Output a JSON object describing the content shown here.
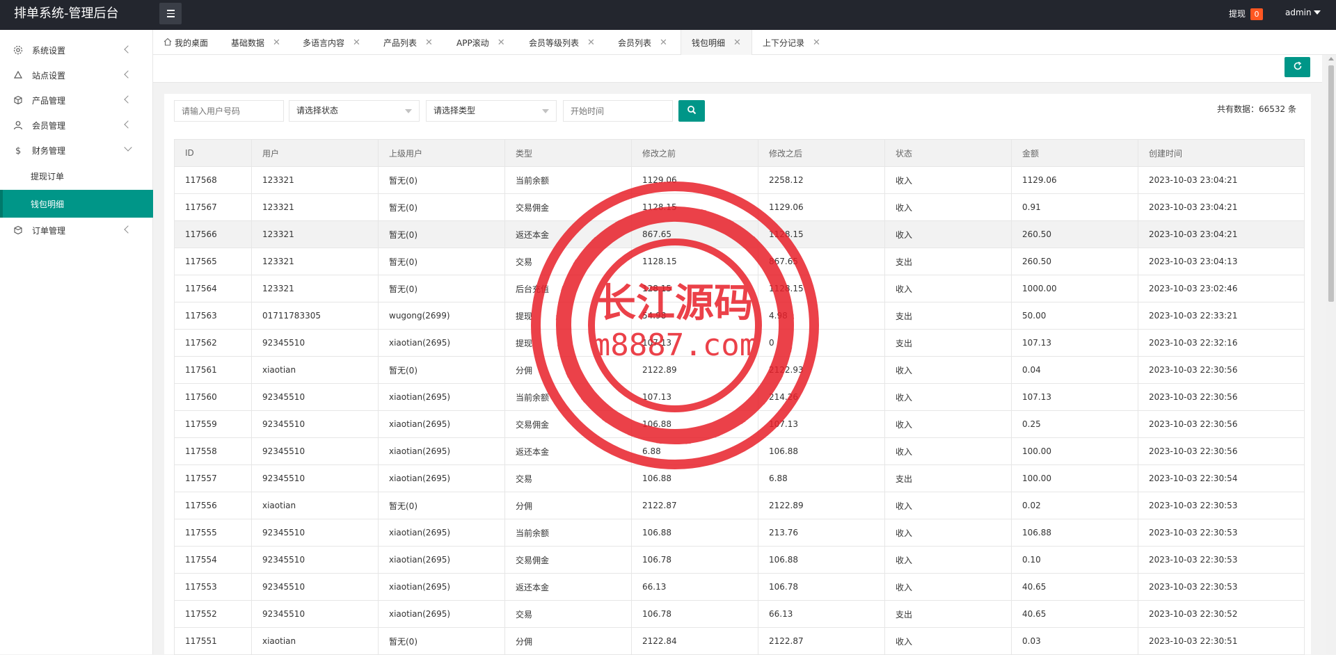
{
  "header": {
    "title": "排单系统-管理后台",
    "withdraw_label": "提现",
    "withdraw_badge": "0",
    "user": "admin"
  },
  "sidebar": {
    "items": [
      {
        "label": "系统设置",
        "icon": "gear-icon"
      },
      {
        "label": "站点设置",
        "icon": "site-icon"
      },
      {
        "label": "产品管理",
        "icon": "box-icon"
      },
      {
        "label": "会员管理",
        "icon": "user-icon"
      },
      {
        "label": "财务管理",
        "icon": "dollar-icon"
      },
      {
        "label": "订单管理",
        "icon": "order-icon"
      }
    ],
    "sub_items": [
      {
        "label": "提现订单"
      },
      {
        "label": "钱包明细"
      }
    ]
  },
  "tabs": [
    {
      "label": "我的桌面"
    },
    {
      "label": "基础数据"
    },
    {
      "label": "多语言内容"
    },
    {
      "label": "产品列表"
    },
    {
      "label": "APP滚动"
    },
    {
      "label": "会员等级列表"
    },
    {
      "label": "会员列表"
    },
    {
      "label": "钱包明细"
    },
    {
      "label": "上下分记录"
    }
  ],
  "filters": {
    "user_placeholder": "请输入用户号码",
    "status_select": "请选择状态",
    "type_select": "请选择类型",
    "time_placeholder": "开始时间"
  },
  "total_text": "共有数据：66532 条",
  "table": {
    "headers": [
      "ID",
      "用户",
      "上级用户",
      "类型",
      "修改之前",
      "修改之后",
      "状态",
      "金额",
      "创建时间"
    ],
    "rows": [
      [
        "117568",
        "123321",
        "暂无(0)",
        "当前余额",
        "1129.06",
        "2258.12",
        "收入",
        "1129.06",
        "2023-10-03 23:04:21"
      ],
      [
        "117567",
        "123321",
        "暂无(0)",
        "交易佣金",
        "1128.15",
        "1129.06",
        "收入",
        "0.91",
        "2023-10-03 23:04:21"
      ],
      [
        "117566",
        "123321",
        "暂无(0)",
        "返还本金",
        "867.65",
        "1128.15",
        "收入",
        "260.50",
        "2023-10-03 23:04:21"
      ],
      [
        "117565",
        "123321",
        "暂无(0)",
        "交易",
        "1128.15",
        "867.65",
        "支出",
        "260.50",
        "2023-10-03 23:04:13"
      ],
      [
        "117564",
        "123321",
        "暂无(0)",
        "后台充值",
        "128.15",
        "1128.15",
        "收入",
        "1000.00",
        "2023-10-03 23:02:46"
      ],
      [
        "117563",
        "01711783305",
        "wugong(2699)",
        "提现",
        "54.98",
        "4.98",
        "支出",
        "50.00",
        "2023-10-03 22:33:21"
      ],
      [
        "117562",
        "92345510",
        "xiaotian(2695)",
        "提现",
        "107.13",
        "0",
        "支出",
        "107.13",
        "2023-10-03 22:32:16"
      ],
      [
        "117561",
        "xiaotian",
        "暂无(0)",
        "分佣",
        "2122.89",
        "2122.93",
        "收入",
        "0.04",
        "2023-10-03 22:30:56"
      ],
      [
        "117560",
        "92345510",
        "xiaotian(2695)",
        "当前余额",
        "107.13",
        "214.26",
        "收入",
        "107.13",
        "2023-10-03 22:30:56"
      ],
      [
        "117559",
        "92345510",
        "xiaotian(2695)",
        "交易佣金",
        "106.88",
        "107.13",
        "收入",
        "0.25",
        "2023-10-03 22:30:56"
      ],
      [
        "117558",
        "92345510",
        "xiaotian(2695)",
        "返还本金",
        "6.88",
        "106.88",
        "收入",
        "100.00",
        "2023-10-03 22:30:56"
      ],
      [
        "117557",
        "92345510",
        "xiaotian(2695)",
        "交易",
        "106.88",
        "6.88",
        "支出",
        "100.00",
        "2023-10-03 22:30:54"
      ],
      [
        "117556",
        "xiaotian",
        "暂无(0)",
        "分佣",
        "2122.87",
        "2122.89",
        "收入",
        "0.02",
        "2023-10-03 22:30:53"
      ],
      [
        "117555",
        "92345510",
        "xiaotian(2695)",
        "当前余额",
        "106.88",
        "213.76",
        "收入",
        "106.88",
        "2023-10-03 22:30:53"
      ],
      [
        "117554",
        "92345510",
        "xiaotian(2695)",
        "交易佣金",
        "106.78",
        "106.88",
        "收入",
        "0.10",
        "2023-10-03 22:30:53"
      ],
      [
        "117553",
        "92345510",
        "xiaotian(2695)",
        "返还本金",
        "66.13",
        "106.78",
        "收入",
        "40.65",
        "2023-10-03 22:30:53"
      ],
      [
        "117552",
        "92345510",
        "xiaotian(2695)",
        "交易",
        "106.78",
        "66.13",
        "支出",
        "40.65",
        "2023-10-03 22:30:52"
      ],
      [
        "117551",
        "xiaotian",
        "暂无(0)",
        "分佣",
        "2122.84",
        "2122.87",
        "收入",
        "0.03",
        "2023-10-03 22:30:51"
      ]
    ]
  },
  "watermark": {
    "line1": "长江源码",
    "line2": "m8887.com",
    "color": "#e8202a"
  },
  "colors": {
    "accent": "#009688",
    "header_bg": "#23262e",
    "badge": "#ff5722"
  }
}
